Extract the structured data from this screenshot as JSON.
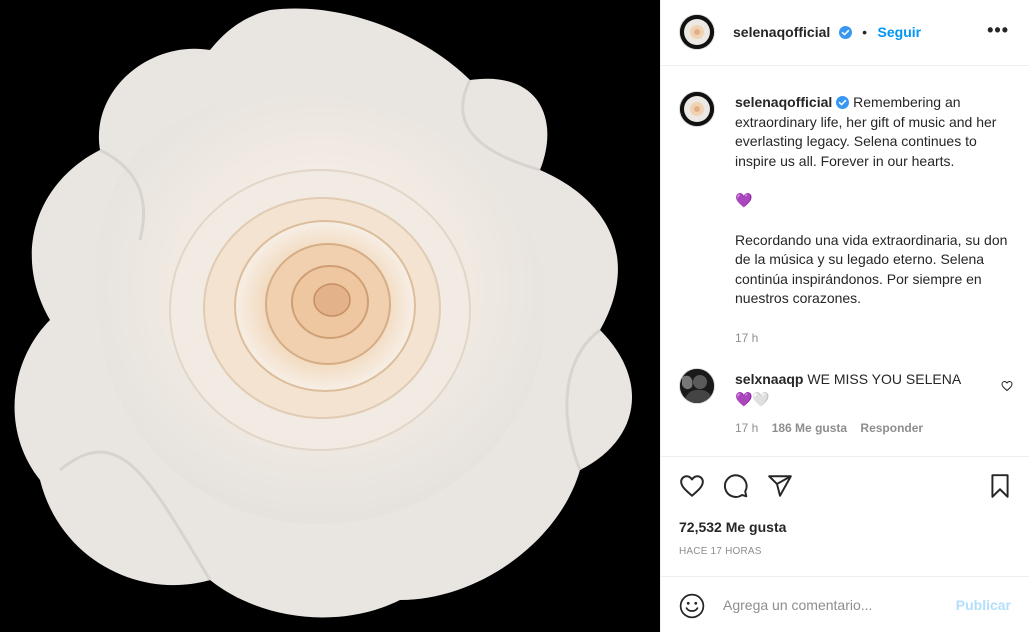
{
  "post": {
    "image_alt": "white-rose-photo",
    "colors": {
      "accent": "#0095f6",
      "verified": "#3897f0",
      "purple_heart": "#8e5ed1",
      "media_bg": "#000000"
    }
  },
  "header": {
    "username": "selenaqofficial",
    "dot": "•",
    "follow_label": "Seguir",
    "more_label": "•••"
  },
  "caption": {
    "username": "selenaqofficial",
    "text_en": "Remembering an extraordinary life, her gift of music and her everlasting legacy. Selena continues to inspire us all. Forever in our hearts.",
    "emoji": "💜",
    "text_es": "Recordando una vida extraordinaria, su don de la música y su legado eterno. Selena continúa inspirándonos. Por siempre en nuestros corazones.",
    "time": "17 h"
  },
  "comment": {
    "username": "selxnaaqp",
    "text": "WE MISS YOU SELENA",
    "emojis": "💜🤍",
    "time": "17 h",
    "likes": "186 Me gusta",
    "reply_label": "Responder"
  },
  "footer": {
    "likes": "72,532 Me gusta",
    "timestamp": "HACE 17 HORAS"
  },
  "composer": {
    "placeholder": "Agrega un comentario...",
    "publish_label": "Publicar"
  }
}
